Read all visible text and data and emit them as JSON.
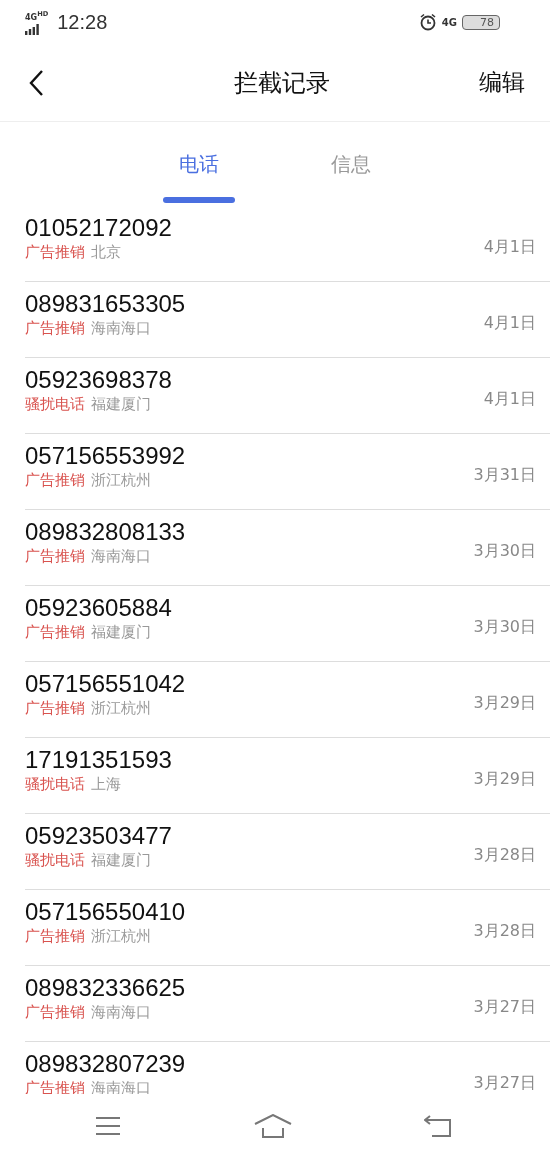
{
  "status_bar": {
    "network": "4G$^{HD}$",
    "time": "12:28",
    "network_right": "4G",
    "battery": "78"
  },
  "header": {
    "title": "拦截记录",
    "action": "编辑"
  },
  "tabs": [
    {
      "label": "电话",
      "selected": true
    },
    {
      "label": "信息",
      "selected": false
    }
  ],
  "records": [
    {
      "number": "01052172092",
      "category": "广告推销",
      "location": "北京",
      "date": "4月1日"
    },
    {
      "number": "089831653305",
      "category": "广告推销",
      "location": "海南海口",
      "date": "4月1日"
    },
    {
      "number": "05923698378",
      "category": "骚扰电话",
      "location": "福建厦门",
      "date": "4月1日"
    },
    {
      "number": "057156553992",
      "category": "广告推销",
      "location": "浙江杭州",
      "date": "3月31日"
    },
    {
      "number": "089832808133",
      "category": "广告推销",
      "location": "海南海口",
      "date": "3月30日"
    },
    {
      "number": "05923605884",
      "category": "广告推销",
      "location": "福建厦门",
      "date": "3月30日"
    },
    {
      "number": "057156551042",
      "category": "广告推销",
      "location": "浙江杭州",
      "date": "3月29日"
    },
    {
      "number": "17191351593",
      "category": "骚扰电话",
      "location": "上海",
      "date": "3月29日"
    },
    {
      "number": "05923503477",
      "category": "骚扰电话",
      "location": "福建厦门",
      "date": "3月28日"
    },
    {
      "number": "057156550410",
      "category": "广告推销",
      "location": "浙江杭州",
      "date": "3月28日"
    },
    {
      "number": "089832336625",
      "category": "广告推销",
      "location": "海南海口",
      "date": "3月27日"
    },
    {
      "number": "089832807239",
      "category": "广告推销",
      "location": "海南海口",
      "date": "3月27日"
    }
  ]
}
